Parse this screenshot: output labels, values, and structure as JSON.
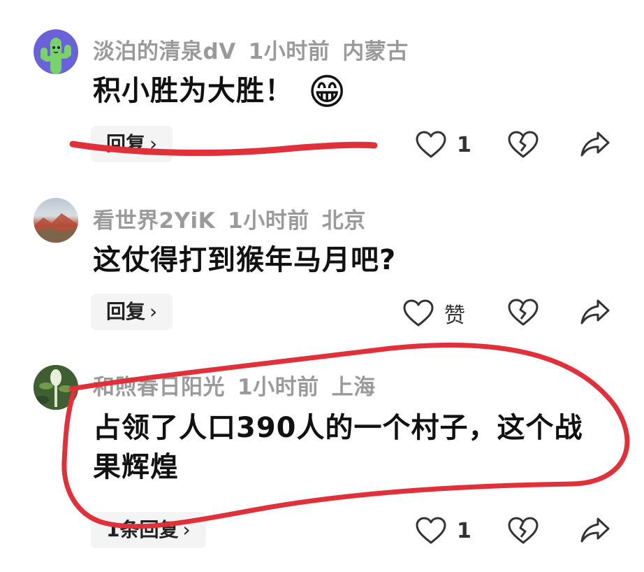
{
  "comments": [
    {
      "author": "淡泊的清泉dV",
      "time": "1小时前",
      "location": "内蒙古",
      "text": "积小胜为大胜！",
      "emoji": "😁",
      "reply_label": "回复",
      "like_count": "1",
      "avatar": "cactus-avatar"
    },
    {
      "author": "看世界2YiK",
      "time": "1小时前",
      "location": "北京",
      "text": "这仗得打到猴年马月吧?",
      "reply_label": "回复",
      "like_count": "赞",
      "avatar": "landscape-avatar"
    },
    {
      "author": "和煦春日阳光",
      "time": "1小时前",
      "location": "上海",
      "text": "占领了人口390人的一个村子，这个战果辉煌",
      "reply_label": "1条回复",
      "like_count": "1",
      "avatar": "plant-avatar"
    }
  ],
  "icons": {
    "like": "heart-icon",
    "dislike": "broken-heart-icon",
    "share": "share-arrow-icon",
    "reply_chevron": "chevron-right-icon"
  },
  "colors": {
    "annotation": "#e0303a",
    "meta_text": "#9a9a9a",
    "body_text": "#111111"
  }
}
